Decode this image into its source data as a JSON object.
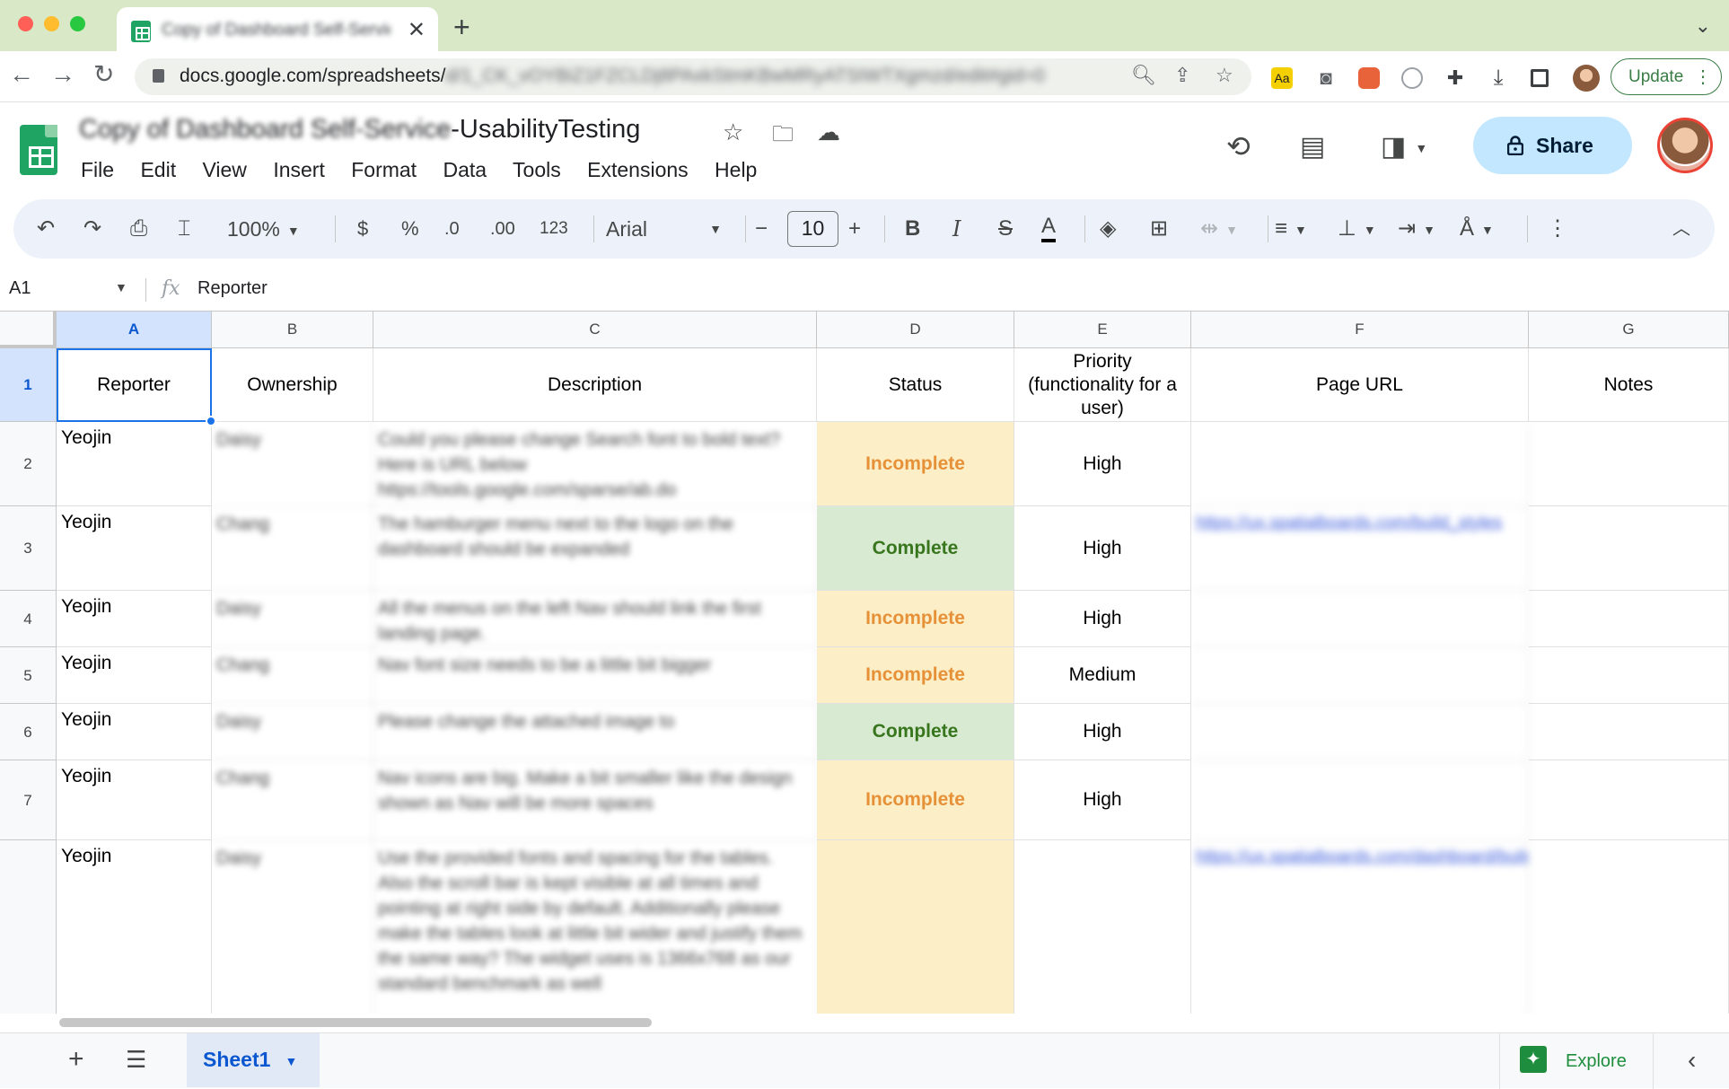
{
  "browser": {
    "tab_title": "Copy of Dashboard Self-Service - Google Sheets",
    "url_host": "docs.google.com/spreadsheets/",
    "url_rest": "d/1_CK_vOYBiZ1FZCLDj8PAxkStmKBwMRyATSIWTXgmzd/edit#gid=0",
    "update_label": "Update",
    "colors": {
      "tabstrip": "#d9e8c6",
      "update": "#3a7d44"
    }
  },
  "doc": {
    "title_blurred": "Copy of Dashboard Self-Service",
    "title_visible": "-UsabilityTesting",
    "menu": [
      "File",
      "Edit",
      "View",
      "Insert",
      "Format",
      "Data",
      "Tools",
      "Extensions",
      "Help"
    ],
    "share_label": "Share"
  },
  "toolbar": {
    "zoom": "100%",
    "currency": "$",
    "percent": "%",
    "dec_less": ".0",
    "dec_more": ".00",
    "more_formats": "123",
    "font": "Arial",
    "font_size": "10",
    "bold": "B",
    "italic": "I",
    "strike": "S",
    "text_color": "A"
  },
  "formula_bar": {
    "cell_ref": "A1",
    "fx": "fx",
    "value": "Reporter"
  },
  "grid": {
    "columns": [
      "A",
      "B",
      "C",
      "D",
      "E",
      "F",
      "G"
    ],
    "rows": [
      "1",
      "2",
      "3",
      "4",
      "5",
      "6",
      "7",
      ""
    ],
    "header": {
      "reporter": "Reporter",
      "ownership": "Ownership",
      "description": "Description",
      "status": "Status",
      "priority": "Priority (functionality for a user)",
      "page_url": "Page URL",
      "notes": "Notes"
    },
    "data": [
      {
        "reporter": "Yeojin",
        "owner": "Daisy",
        "desc": "Could you please change Search font to bold text? Here is URL below https://tools.google.com/sparse/ab.do",
        "status": "Incomplete",
        "priority": "High",
        "url": ""
      },
      {
        "reporter": "Yeojin",
        "owner": "Chang",
        "desc": "The hamburger menu next to the logo on the dashboard should be expanded",
        "status": "Complete",
        "priority": "High",
        "url": "https://ux.spatialboards.com/build_styles"
      },
      {
        "reporter": "Yeojin",
        "owner": "Daisy",
        "desc": "All the menus on the left Nav should link the first landing page.",
        "status": "Incomplete",
        "priority": "High",
        "url": ""
      },
      {
        "reporter": "Yeojin",
        "owner": "Chang",
        "desc": "Nav font size needs to be a little bit bigger",
        "status": "Incomplete",
        "priority": "Medium",
        "url": ""
      },
      {
        "reporter": "Yeojin",
        "owner": "Daisy",
        "desc": "Please change the attached image to",
        "status": "Complete",
        "priority": "High",
        "url": ""
      },
      {
        "reporter": "Yeojin",
        "owner": "Chang",
        "desc": "Nav icons are big. Make a bit smaller like the design shown as Nav will be more spaces",
        "status": "Incomplete",
        "priority": "High",
        "url": ""
      },
      {
        "reporter": "Yeojin",
        "owner": "Daisy",
        "desc": "Use the provided fonts and spacing for the tables. Also the scroll bar is kept visible at all times and pointing at right side by default. Additionally please make the tables look at little bit wider and justify them the same way? The widget uses is 1366x768 as our standard benchmark as well",
        "status": "",
        "priority": "",
        "url": "https://ux.spatialboards.com/dashboard/build_styles/hierarchical_table_widget"
      }
    ]
  },
  "sheets": {
    "active": "Sheet1",
    "explore_label": "Explore"
  }
}
